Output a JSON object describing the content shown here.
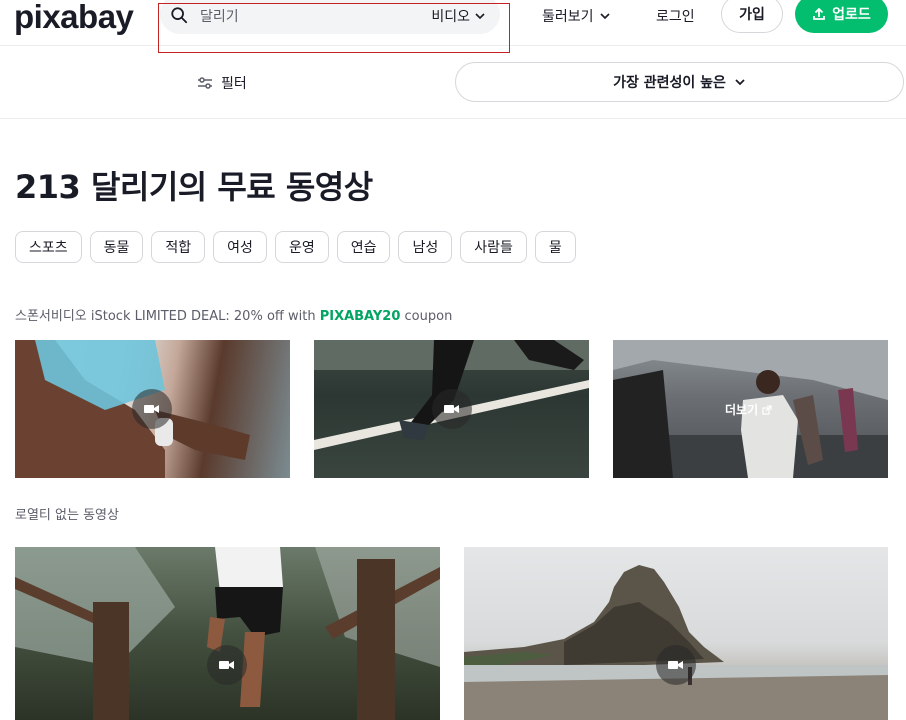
{
  "header": {
    "logo": "pixabay",
    "search_placeholder": "달리기",
    "search_type": "비디오",
    "explore": "둘러보기",
    "login": "로그인",
    "join": "가입",
    "upload": "업로드"
  },
  "filters": {
    "filter_label": "필터",
    "sort_label": "가장 관련성이 높은"
  },
  "page_title": "213 달리기의 무료 동영상",
  "tags": [
    "스포츠",
    "동물",
    "적합",
    "여성",
    "운영",
    "연습",
    "남성",
    "사람들",
    "물"
  ],
  "sponsor": {
    "prefix": "스폰서비디오 iStock LIMITED DEAL: 20% off with ",
    "code": "PIXABAY20",
    "suffix": " coupon"
  },
  "sponsored_more_label": "더보기",
  "section_label": "로열티 없는 동영상",
  "colors": {
    "brand_green": "#02be6e",
    "highlight_red": "#c52323"
  }
}
